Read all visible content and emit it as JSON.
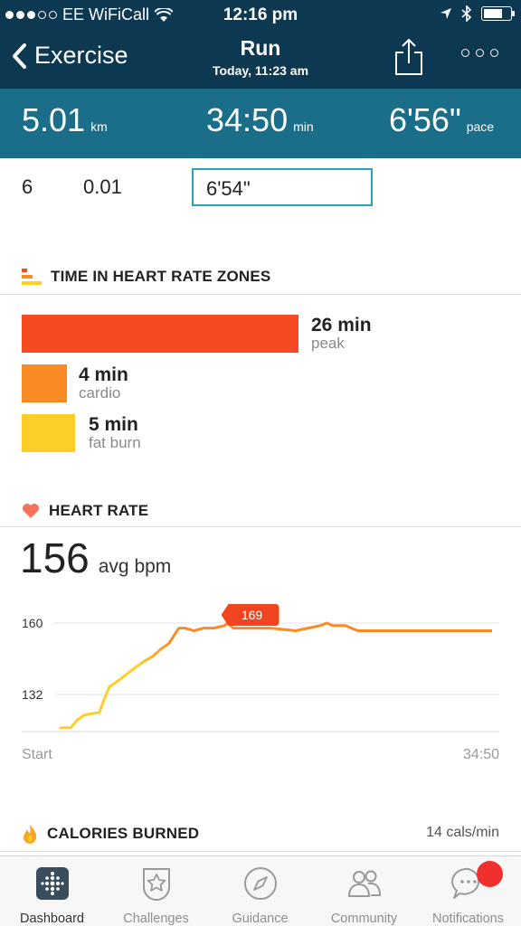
{
  "status_bar": {
    "carrier": "EE WiFiCall",
    "time": "12:16 pm",
    "signal_icon": "signal-dots-icon",
    "wifi_icon": "wifi-icon",
    "location_icon": "location-arrow-icon",
    "bluetooth_icon": "bluetooth-icon",
    "battery_icon": "battery-icon"
  },
  "nav": {
    "back_label": "Exercise",
    "title": "Run",
    "subtitle": "Today, 11:23 am",
    "share_icon": "share-icon",
    "more_icon": "more-dots-icon"
  },
  "summary": {
    "distance_value": "5.01",
    "distance_unit": "km",
    "duration_value": "34:50",
    "duration_unit": "min",
    "pace_value": "6'56\"",
    "pace_unit": "pace"
  },
  "split_row": {
    "number": "6",
    "distance": "0.01",
    "pace": "6'54\""
  },
  "zones": {
    "heading": "TIME IN HEART RATE ZONES",
    "items": [
      {
        "value": "26 min",
        "label": "peak",
        "color": "#f64a22",
        "minutes": 26
      },
      {
        "value": "4 min",
        "label": "cardio",
        "color": "#f98a24",
        "minutes": 4
      },
      {
        "value": "5 min",
        "label": "fat burn",
        "color": "#fcce27",
        "minutes": 5
      }
    ]
  },
  "heart_rate": {
    "heading": "HEART RATE",
    "avg_value": "156",
    "avg_unit": "avg bpm"
  },
  "chart_data": {
    "type": "line",
    "title": "",
    "xlabel": "",
    "ylabel": "",
    "x_tick_labels": [
      "Start",
      "34:50"
    ],
    "y_ticks": [
      132,
      160
    ],
    "ylim": [
      100,
      175
    ],
    "xlim": [
      0,
      34.83
    ],
    "max_marker": {
      "label": "169",
      "x": 13.3,
      "value": 169
    },
    "series": [
      {
        "x": [
          0,
          0.9,
          1.4,
          2.0,
          3.2,
          3.5,
          4.0,
          4.6,
          5.4,
          6.2,
          6.8,
          7.5,
          8.2,
          8.8,
          9.6,
          10.1,
          10.8,
          11.6,
          12.4,
          13.3,
          13.5,
          14.0,
          15.0,
          17.0,
          19.0,
          20.0,
          21.0,
          21.5,
          22.0,
          23.0,
          24.0,
          26.0,
          28.0,
          30.0,
          32.0,
          34.0,
          34.83
        ],
        "y": [
          119,
          119,
          122,
          124,
          125,
          129,
          135,
          137,
          140,
          143,
          145,
          147,
          150,
          152,
          158,
          158,
          157,
          158,
          158,
          159,
          160,
          158,
          158,
          158,
          157,
          158,
          159,
          160,
          159,
          159,
          157,
          157,
          157,
          157,
          157,
          157,
          157
        ]
      }
    ],
    "grid": true,
    "line_colors": [
      "#fcce27",
      "#f98a24"
    ]
  },
  "calories": {
    "heading": "CALORIES BURNED",
    "rate": "14 cals/min"
  },
  "tabs": [
    {
      "label": "Dashboard",
      "icon": "dashboard-icon",
      "active": true
    },
    {
      "label": "Challenges",
      "icon": "challenges-star-icon",
      "active": false
    },
    {
      "label": "Guidance",
      "icon": "guidance-compass-icon",
      "active": false
    },
    {
      "label": "Community",
      "icon": "community-people-icon",
      "active": false
    },
    {
      "label": "Notifications",
      "icon": "notifications-chat-icon",
      "active": false
    }
  ],
  "colors": {
    "header_bg": "#0d3852",
    "summary_bg": "#1a6e8a",
    "accent_teal": "#2aa3b8",
    "notification_badge": "#f0302f"
  }
}
